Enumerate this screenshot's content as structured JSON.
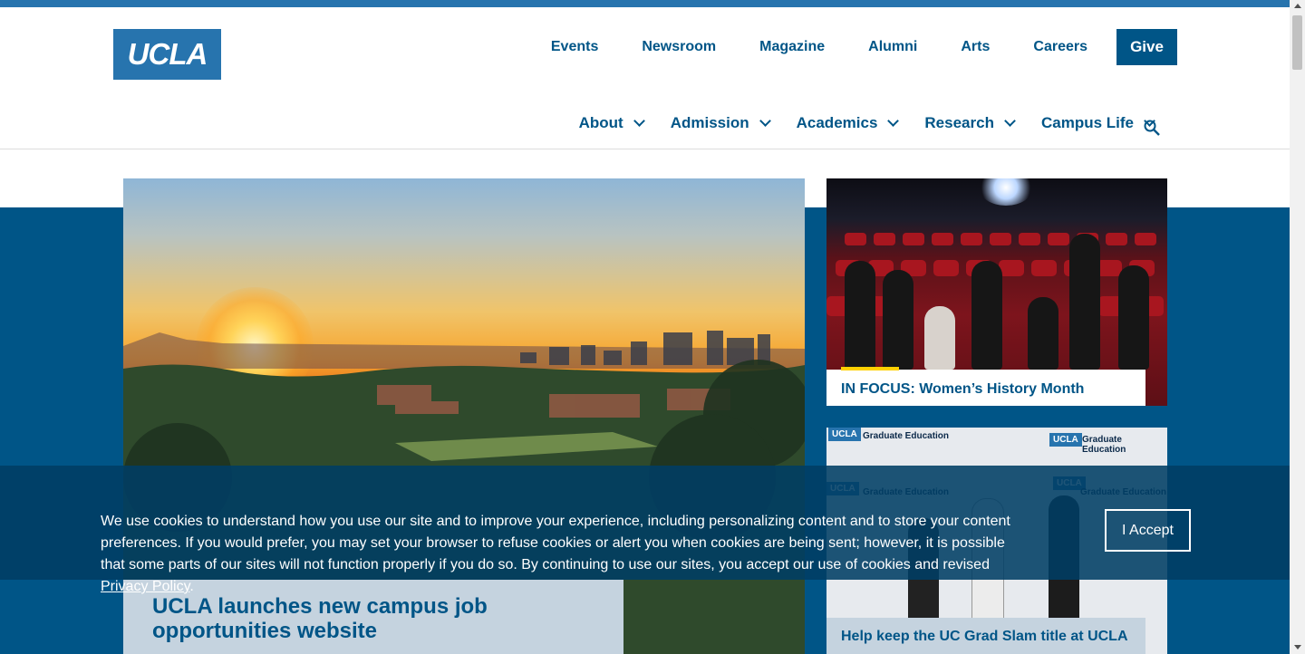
{
  "logo": {
    "text": "UCLA"
  },
  "utility_nav": [
    {
      "label": "Events"
    },
    {
      "label": "Newsroom"
    },
    {
      "label": "Magazine"
    },
    {
      "label": "Alumni"
    },
    {
      "label": "Arts"
    },
    {
      "label": "Careers"
    }
  ],
  "give_label": "Give",
  "main_nav": [
    {
      "label": "About"
    },
    {
      "label": "Admission"
    },
    {
      "label": "Academics"
    },
    {
      "label": "Research"
    },
    {
      "label": "Campus Life"
    }
  ],
  "search": {
    "icon": "search-icon"
  },
  "hero": {
    "title": "UCLA launches new campus job opportunities website"
  },
  "cards": [
    {
      "title": "IN FOCUS: Women’s History Month"
    },
    {
      "title": "Help keep the UC Grad Slam title at UCLA"
    }
  ],
  "card2_photo": {
    "logo_chip": "UCLA",
    "logo_text": "Graduate Education"
  },
  "cookie": {
    "text": "We use cookies to understand how you use our site and to improve your experience, including personalizing content and to store your content preferences. If you would prefer, you may set your browser to refuse cookies or alert you when cookies are being sent; however, it is possible that some parts of our sites will not function properly if you do so. By continuing to use our sites, you accept our use of cookies and revised",
    "link_text": "Privacy Policy",
    "accept_label": "I Accept"
  },
  "colors": {
    "brand_blue": "#2774ae",
    "dark_blue": "#005587",
    "gold": "#ffd100"
  }
}
